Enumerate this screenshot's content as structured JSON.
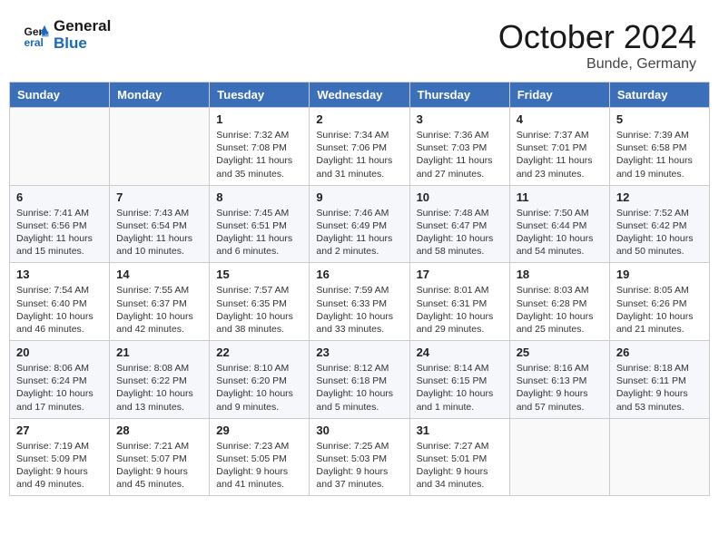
{
  "header": {
    "logo_line1": "General",
    "logo_line2": "Blue",
    "month": "October 2024",
    "location": "Bunde, Germany"
  },
  "weekdays": [
    "Sunday",
    "Monday",
    "Tuesday",
    "Wednesday",
    "Thursday",
    "Friday",
    "Saturday"
  ],
  "weeks": [
    [
      {
        "day": "",
        "sunrise": "",
        "sunset": "",
        "daylight": ""
      },
      {
        "day": "",
        "sunrise": "",
        "sunset": "",
        "daylight": ""
      },
      {
        "day": "1",
        "sunrise": "Sunrise: 7:32 AM",
        "sunset": "Sunset: 7:08 PM",
        "daylight": "Daylight: 11 hours and 35 minutes."
      },
      {
        "day": "2",
        "sunrise": "Sunrise: 7:34 AM",
        "sunset": "Sunset: 7:06 PM",
        "daylight": "Daylight: 11 hours and 31 minutes."
      },
      {
        "day": "3",
        "sunrise": "Sunrise: 7:36 AM",
        "sunset": "Sunset: 7:03 PM",
        "daylight": "Daylight: 11 hours and 27 minutes."
      },
      {
        "day": "4",
        "sunrise": "Sunrise: 7:37 AM",
        "sunset": "Sunset: 7:01 PM",
        "daylight": "Daylight: 11 hours and 23 minutes."
      },
      {
        "day": "5",
        "sunrise": "Sunrise: 7:39 AM",
        "sunset": "Sunset: 6:58 PM",
        "daylight": "Daylight: 11 hours and 19 minutes."
      }
    ],
    [
      {
        "day": "6",
        "sunrise": "Sunrise: 7:41 AM",
        "sunset": "Sunset: 6:56 PM",
        "daylight": "Daylight: 11 hours and 15 minutes."
      },
      {
        "day": "7",
        "sunrise": "Sunrise: 7:43 AM",
        "sunset": "Sunset: 6:54 PM",
        "daylight": "Daylight: 11 hours and 10 minutes."
      },
      {
        "day": "8",
        "sunrise": "Sunrise: 7:45 AM",
        "sunset": "Sunset: 6:51 PM",
        "daylight": "Daylight: 11 hours and 6 minutes."
      },
      {
        "day": "9",
        "sunrise": "Sunrise: 7:46 AM",
        "sunset": "Sunset: 6:49 PM",
        "daylight": "Daylight: 11 hours and 2 minutes."
      },
      {
        "day": "10",
        "sunrise": "Sunrise: 7:48 AM",
        "sunset": "Sunset: 6:47 PM",
        "daylight": "Daylight: 10 hours and 58 minutes."
      },
      {
        "day": "11",
        "sunrise": "Sunrise: 7:50 AM",
        "sunset": "Sunset: 6:44 PM",
        "daylight": "Daylight: 10 hours and 54 minutes."
      },
      {
        "day": "12",
        "sunrise": "Sunrise: 7:52 AM",
        "sunset": "Sunset: 6:42 PM",
        "daylight": "Daylight: 10 hours and 50 minutes."
      }
    ],
    [
      {
        "day": "13",
        "sunrise": "Sunrise: 7:54 AM",
        "sunset": "Sunset: 6:40 PM",
        "daylight": "Daylight: 10 hours and 46 minutes."
      },
      {
        "day": "14",
        "sunrise": "Sunrise: 7:55 AM",
        "sunset": "Sunset: 6:37 PM",
        "daylight": "Daylight: 10 hours and 42 minutes."
      },
      {
        "day": "15",
        "sunrise": "Sunrise: 7:57 AM",
        "sunset": "Sunset: 6:35 PM",
        "daylight": "Daylight: 10 hours and 38 minutes."
      },
      {
        "day": "16",
        "sunrise": "Sunrise: 7:59 AM",
        "sunset": "Sunset: 6:33 PM",
        "daylight": "Daylight: 10 hours and 33 minutes."
      },
      {
        "day": "17",
        "sunrise": "Sunrise: 8:01 AM",
        "sunset": "Sunset: 6:31 PM",
        "daylight": "Daylight: 10 hours and 29 minutes."
      },
      {
        "day": "18",
        "sunrise": "Sunrise: 8:03 AM",
        "sunset": "Sunset: 6:28 PM",
        "daylight": "Daylight: 10 hours and 25 minutes."
      },
      {
        "day": "19",
        "sunrise": "Sunrise: 8:05 AM",
        "sunset": "Sunset: 6:26 PM",
        "daylight": "Daylight: 10 hours and 21 minutes."
      }
    ],
    [
      {
        "day": "20",
        "sunrise": "Sunrise: 8:06 AM",
        "sunset": "Sunset: 6:24 PM",
        "daylight": "Daylight: 10 hours and 17 minutes."
      },
      {
        "day": "21",
        "sunrise": "Sunrise: 8:08 AM",
        "sunset": "Sunset: 6:22 PM",
        "daylight": "Daylight: 10 hours and 13 minutes."
      },
      {
        "day": "22",
        "sunrise": "Sunrise: 8:10 AM",
        "sunset": "Sunset: 6:20 PM",
        "daylight": "Daylight: 10 hours and 9 minutes."
      },
      {
        "day": "23",
        "sunrise": "Sunrise: 8:12 AM",
        "sunset": "Sunset: 6:18 PM",
        "daylight": "Daylight: 10 hours and 5 minutes."
      },
      {
        "day": "24",
        "sunrise": "Sunrise: 8:14 AM",
        "sunset": "Sunset: 6:15 PM",
        "daylight": "Daylight: 10 hours and 1 minute."
      },
      {
        "day": "25",
        "sunrise": "Sunrise: 8:16 AM",
        "sunset": "Sunset: 6:13 PM",
        "daylight": "Daylight: 9 hours and 57 minutes."
      },
      {
        "day": "26",
        "sunrise": "Sunrise: 8:18 AM",
        "sunset": "Sunset: 6:11 PM",
        "daylight": "Daylight: 9 hours and 53 minutes."
      }
    ],
    [
      {
        "day": "27",
        "sunrise": "Sunrise: 7:19 AM",
        "sunset": "Sunset: 5:09 PM",
        "daylight": "Daylight: 9 hours and 49 minutes."
      },
      {
        "day": "28",
        "sunrise": "Sunrise: 7:21 AM",
        "sunset": "Sunset: 5:07 PM",
        "daylight": "Daylight: 9 hours and 45 minutes."
      },
      {
        "day": "29",
        "sunrise": "Sunrise: 7:23 AM",
        "sunset": "Sunset: 5:05 PM",
        "daylight": "Daylight: 9 hours and 41 minutes."
      },
      {
        "day": "30",
        "sunrise": "Sunrise: 7:25 AM",
        "sunset": "Sunset: 5:03 PM",
        "daylight": "Daylight: 9 hours and 37 minutes."
      },
      {
        "day": "31",
        "sunrise": "Sunrise: 7:27 AM",
        "sunset": "Sunset: 5:01 PM",
        "daylight": "Daylight: 9 hours and 34 minutes."
      },
      {
        "day": "",
        "sunrise": "",
        "sunset": "",
        "daylight": ""
      },
      {
        "day": "",
        "sunrise": "",
        "sunset": "",
        "daylight": ""
      }
    ]
  ]
}
